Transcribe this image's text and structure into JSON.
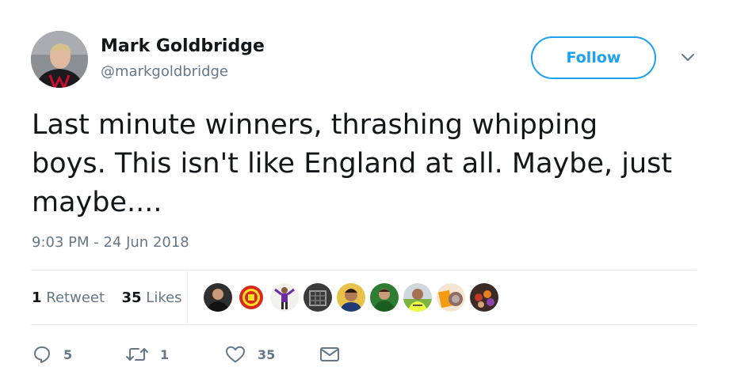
{
  "author": {
    "name": "Mark Goldbridge",
    "handle": "@markgoldbridge"
  },
  "follow_button": {
    "label": "Follow"
  },
  "tweet": {
    "text": "Last minute winners, thrashing whipping\nboys. This isn't like England at all. Maybe, just\nmaybe....",
    "timestamp": "9:03 PM - 24 Jun 2018"
  },
  "stats": {
    "retweets": {
      "count": "1",
      "label": "Retweet"
    },
    "likes": {
      "count": "35",
      "label": "Likes"
    }
  },
  "liked_by_avatars": [
    {
      "icon": "person-avatar"
    },
    {
      "icon": "club-crest-avatar"
    },
    {
      "icon": "player-avatar"
    },
    {
      "icon": "dark-avatar"
    },
    {
      "icon": "person-avatar"
    },
    {
      "icon": "goalkeeper-avatar"
    },
    {
      "icon": "person-avatar"
    },
    {
      "icon": "book-avatar"
    },
    {
      "icon": "group-avatar"
    }
  ],
  "actions": {
    "reply": {
      "icon": "reply-icon",
      "count": "5"
    },
    "retweet": {
      "icon": "retweet-icon",
      "count": "1"
    },
    "like": {
      "icon": "heart-icon",
      "count": "35"
    },
    "message": {
      "icon": "envelope-icon"
    }
  },
  "colors": {
    "accent": "#1da1f2",
    "text": "#14171a",
    "secondary_text": "#657786",
    "divider": "#e6ecf0"
  }
}
